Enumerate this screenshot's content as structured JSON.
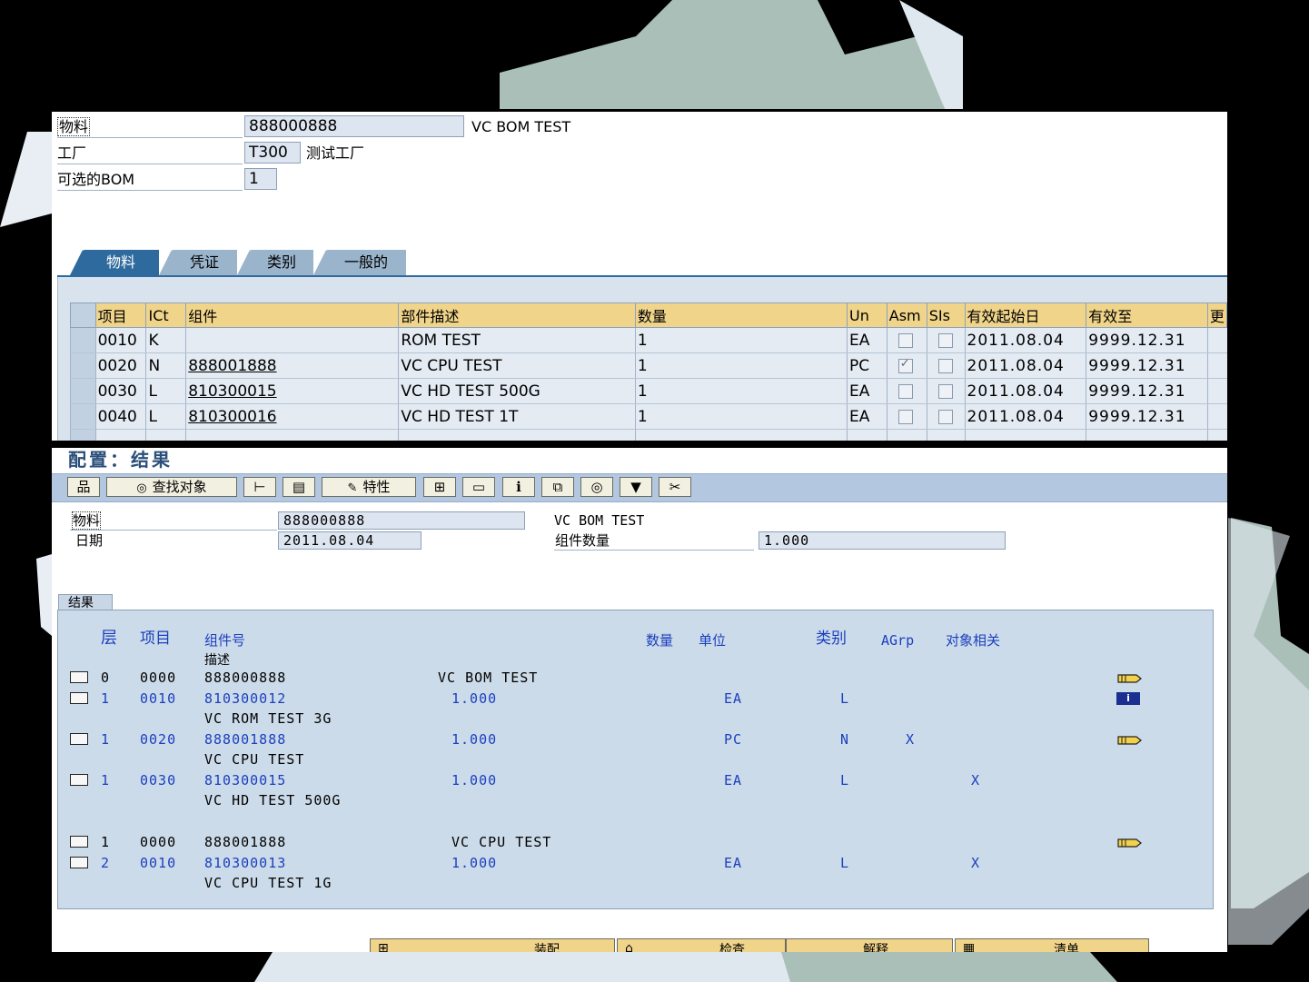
{
  "top": {
    "header": {
      "material_label": "物料",
      "material_value": "888000888",
      "material_desc": "VC BOM TEST",
      "plant_label": "工厂",
      "plant_value": "T300",
      "plant_desc": "测试工厂",
      "alt_bom_label": "可选的BOM",
      "alt_bom_value": "1"
    },
    "tabs": [
      "物料",
      "凭证",
      "类别",
      "一般的"
    ],
    "table": {
      "columns": [
        "项目",
        "ICt",
        "组件",
        "部件描述",
        "数量",
        "Un",
        "Asm",
        "SIs",
        "有效起始日",
        "有效至",
        "更"
      ],
      "rows": [
        {
          "item": "0010",
          "ict": "K",
          "component": "",
          "desc": "ROM TEST",
          "qty": "1",
          "un": "EA",
          "asm": false,
          "sis": false,
          "valid_from": "2011.08.04",
          "valid_to": "9999.12.31"
        },
        {
          "item": "0020",
          "ict": "N",
          "component": "888001888",
          "desc": "VC CPU TEST",
          "qty": "1",
          "un": "PC",
          "asm": true,
          "sis": false,
          "valid_from": "2011.08.04",
          "valid_to": "9999.12.31"
        },
        {
          "item": "0030",
          "ict": "L",
          "component": "810300015",
          "desc": "VC HD TEST 500G",
          "qty": "1",
          "un": "EA",
          "asm": false,
          "sis": false,
          "valid_from": "2011.08.04",
          "valid_to": "9999.12.31"
        },
        {
          "item": "0040",
          "ict": "L",
          "component": "810300016",
          "desc": "VC HD TEST 1T",
          "qty": "1",
          "un": "EA",
          "asm": false,
          "sis": false,
          "valid_from": "2011.08.04",
          "valid_to": "9999.12.31"
        }
      ]
    }
  },
  "bottom": {
    "title": "配置：结果",
    "toolbar": {
      "find_object": "查找对象",
      "characteristics": "特性"
    },
    "header": {
      "material_label": "物料",
      "material_value": "888000888",
      "material_desc": "VC BOM TEST",
      "date_label": "日期",
      "date_value": "2011.08.04",
      "comp_qty_label": "组件数量",
      "comp_qty_value": "1.000"
    },
    "result_tab": "结果",
    "result_headers": {
      "level": "层",
      "item": "项目",
      "component": "组件号",
      "description": "描述",
      "quantity": "数量",
      "unit": "单位",
      "category": "类别",
      "agrp": "AGrp",
      "object_dep": "对象相关"
    },
    "rows": [
      {
        "level": "0",
        "item": "0000",
        "component": "888000888",
        "desc_inline": "VC BOM TEST",
        "qty": "",
        "unit": "",
        "cat": "",
        "agrp": "",
        "dep": "",
        "desc": "",
        "color": "blk",
        "icon": "pen"
      },
      {
        "level": "1",
        "item": "0010",
        "component": "810300012",
        "desc_inline": "",
        "qty": "1.000",
        "unit": "EA",
        "cat": "L",
        "agrp": "",
        "dep": "",
        "desc": "VC ROM TEST 3G",
        "color": "blu",
        "icon": "info"
      },
      {
        "level": "1",
        "item": "0020",
        "component": "888001888",
        "desc_inline": "",
        "qty": "1.000",
        "unit": "PC",
        "cat": "N",
        "agrp": "X",
        "dep": "",
        "desc": "VC CPU TEST",
        "color": "blu",
        "icon": "pen"
      },
      {
        "level": "1",
        "item": "0030",
        "component": "810300015",
        "desc_inline": "",
        "qty": "1.000",
        "unit": "EA",
        "cat": "L",
        "agrp": "",
        "dep": "X",
        "desc": "VC HD TEST 500G",
        "color": "blu",
        "icon": ""
      },
      {
        "level": "1",
        "item": "0000",
        "component": "888001888",
        "desc_inline": "VC CPU TEST",
        "qty": "",
        "unit": "",
        "cat": "",
        "agrp": "",
        "dep": "",
        "desc": "",
        "color": "blk",
        "icon": "pen"
      },
      {
        "level": "2",
        "item": "0010",
        "component": "810300013",
        "desc_inline": "",
        "qty": "1.000",
        "unit": "EA",
        "cat": "L",
        "agrp": "",
        "dep": "X",
        "desc": "VC CPU TEST 1G",
        "color": "blu",
        "icon": ""
      }
    ],
    "buttons": [
      "装配",
      "检查",
      "解释",
      "清单"
    ]
  }
}
